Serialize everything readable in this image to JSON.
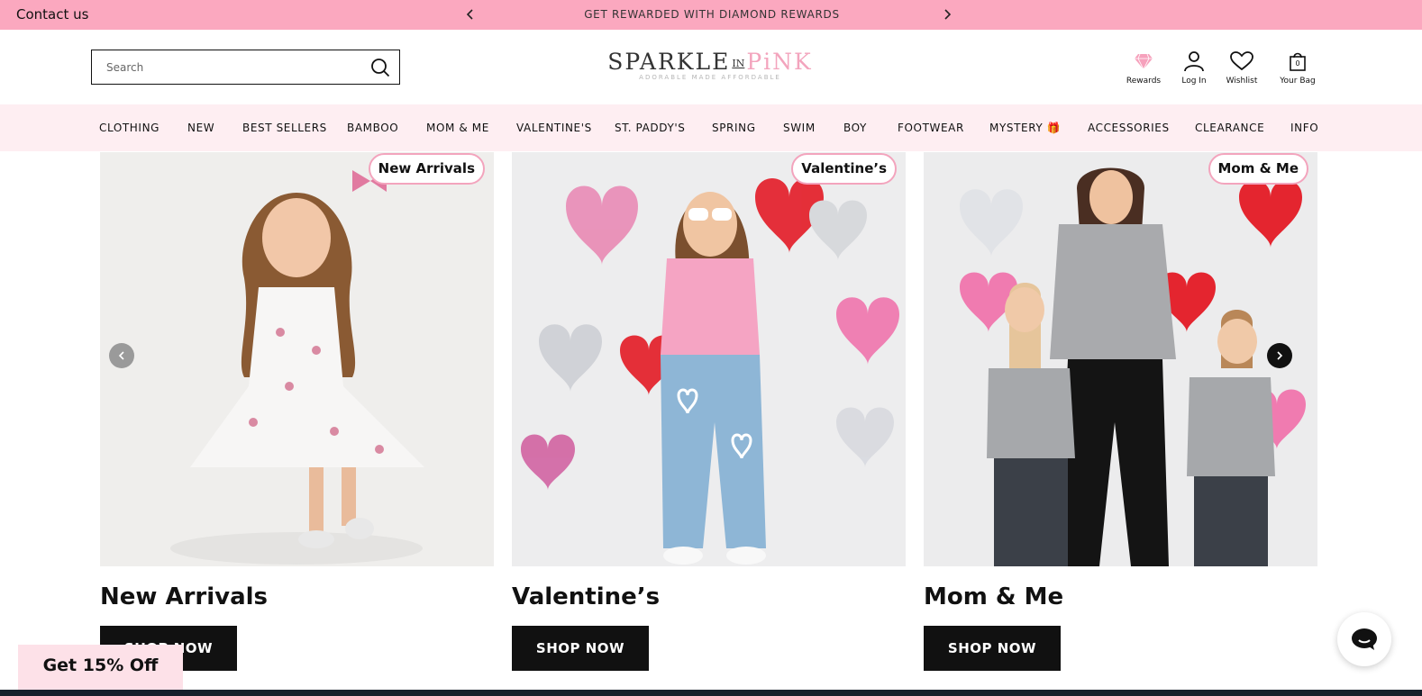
{
  "announcement": {
    "contact": "Contact us",
    "message": "GET REWARDED WITH DIAMOND REWARDS"
  },
  "header": {
    "search_placeholder": "Search",
    "logo_part1": "SPARKLE",
    "logo_in": "IN",
    "logo_part2": "PiNK",
    "logo_tagline": "ADORABLE MADE AFFORDABLE",
    "utilities": {
      "rewards": "Rewards",
      "login": "Log In",
      "wishlist": "Wishlist",
      "bag": "Your Bag",
      "bag_count": "0"
    }
  },
  "nav": [
    "CLOTHING",
    "NEW",
    "BEST SELLERS",
    "BAMBOO",
    "MOM & ME",
    "VALENTINE'S",
    "ST. PADDY'S",
    "SPRING",
    "SWIM",
    "BOY",
    "FOOTWEAR",
    "MYSTERY 🎁",
    "ACCESSORIES",
    "CLEARANCE",
    "INFO"
  ],
  "cards": [
    {
      "badge": "New Arrivals",
      "title": "New Arrivals",
      "button": "SHOP NOW"
    },
    {
      "badge": "Valentine’s",
      "title": "Valentine’s",
      "button": "SHOP NOW"
    },
    {
      "badge": "Mom & Me",
      "title": "Mom & Me",
      "button": "SHOP NOW"
    }
  ],
  "promo": "Get 15% Off",
  "colors": {
    "announcement_bg": "#fba8bf",
    "nav_bg": "#feeef2",
    "accent_pink": "#f3a4bd",
    "button_bg": "#111111"
  }
}
